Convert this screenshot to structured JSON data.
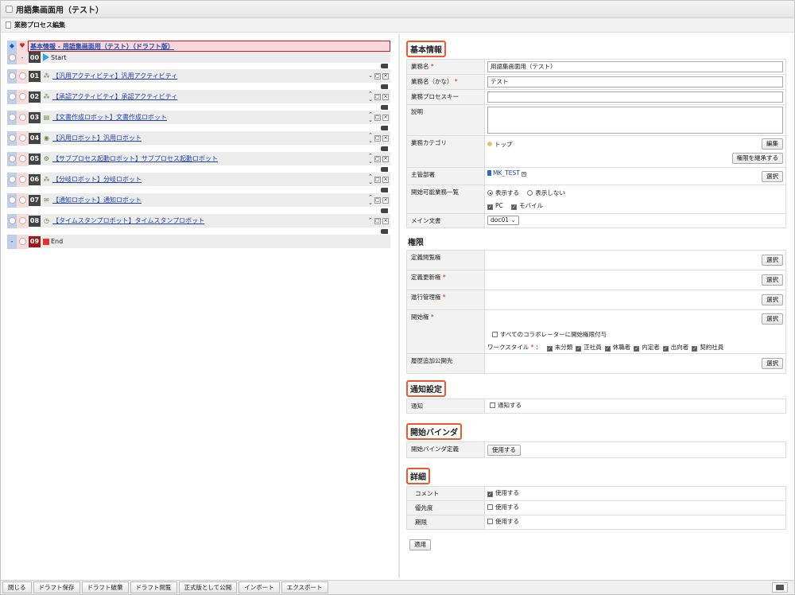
{
  "window": {
    "title": "用語集画面用（テスト）"
  },
  "subheader": {
    "title": "業務プロセス編集"
  },
  "process": {
    "header_link": "基本情報 - 用語集画面用（テスト）（ドラフト版）",
    "start": {
      "num": "00",
      "label": "Start"
    },
    "steps": [
      {
        "num": "01",
        "label": "【汎用アクティビティ】汎用アクティビティ",
        "icon": "activity-icon"
      },
      {
        "num": "02",
        "label": "【承認アクティビティ】承認アクティビティ",
        "icon": "approval-icon"
      },
      {
        "num": "03",
        "label": "【文書作成ロボット】文書作成ロボット",
        "icon": "document-robot-icon"
      },
      {
        "num": "04",
        "label": "【汎用ロボット】汎用ロボット",
        "icon": "robot-icon"
      },
      {
        "num": "05",
        "label": "【サブプロセス起動ロボット】サブプロセス起動ロボット",
        "icon": "subprocess-icon"
      },
      {
        "num": "06",
        "label": "【分岐ロボット】分岐ロボット",
        "icon": "branch-icon"
      },
      {
        "num": "07",
        "label": "【通知ロボット】通知ロボット",
        "icon": "notify-icon"
      },
      {
        "num": "08",
        "label": "【タイムスタンプロボット】タイムスタンプロボット",
        "icon": "timestamp-icon"
      }
    ],
    "end": {
      "num": "09",
      "label": "End"
    }
  },
  "basic": {
    "title": "基本情報",
    "name_label": "業務名",
    "name_value": "用語集画面用（テスト）",
    "kana_label": "業務名（かな）",
    "kana_value": "テスト",
    "key_label": "業務プロセスキー",
    "key_value": "",
    "desc_label": "説明",
    "category_label": "業務カテゴリ",
    "category_value": "トップ",
    "edit_button": "編集",
    "inherit_button": "権限を継承する",
    "dept_label": "主管部署",
    "dept_value": "MK_TEST",
    "select_button": "選択",
    "list_label": "開始可能業務一覧",
    "radio_show": "表示する",
    "radio_hide": "表示しない",
    "pc_label": "PC",
    "mobile_label": "モバイル",
    "main_doc_label": "メイン文書",
    "main_doc_value": "doc01"
  },
  "permissions": {
    "title": "権限",
    "view_label": "定義閲覧権",
    "update_label": "定義更新権",
    "progress_label": "進行管理権",
    "start_label": "開始権",
    "collab_label": "すべてのコラボレーターに開始権限付与",
    "workstyle_label": "ワークスタイル",
    "workstyles": [
      "未分類",
      "正社員",
      "休職者",
      "内定者",
      "出向者",
      "契約社員"
    ],
    "history_label": "履歴追加公開先",
    "select_button": "選択"
  },
  "notification": {
    "title": "通知設定",
    "label": "通知",
    "checkbox_label": "通知する"
  },
  "binder": {
    "title": "開始バインダ",
    "label": "開始バインダ定義",
    "button": "使用する"
  },
  "details": {
    "title": "詳細",
    "comment_label": "コメント",
    "priority_label": "優先度",
    "deadline_label": "期限",
    "use_label": "使用する"
  },
  "apply_button": "適用",
  "bottom": {
    "buttons": [
      "閉じる",
      "ドラフト保存",
      "ドラフト破棄",
      "ドラフト閲覧",
      "正式版として公開",
      "インポート",
      "エクスポート"
    ]
  }
}
